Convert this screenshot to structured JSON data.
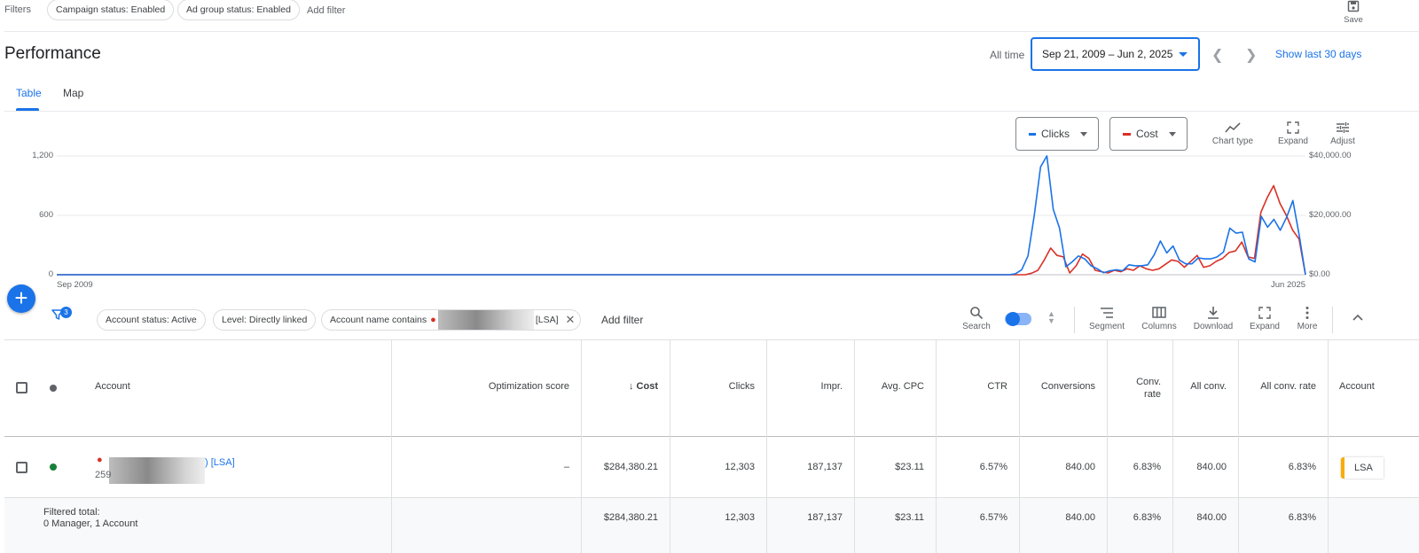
{
  "filters": {
    "label": "Filters",
    "chips": [
      "Campaign status: Enabled",
      "Ad group status: Enabled"
    ],
    "add_filter": "Add filter",
    "save_label": "Save"
  },
  "header": {
    "title": "Performance",
    "range_label": "All time",
    "date_range": "Sep 21, 2009 – Jun 2, 2025",
    "show_last": "Show last 30 days"
  },
  "tabs": [
    "Table",
    "Map"
  ],
  "chart_controls": {
    "metric1": "Clicks",
    "metric2": "Cost",
    "tools": [
      "Chart type",
      "Expand",
      "Adjust"
    ]
  },
  "colors": {
    "clicks": "#1a73e8",
    "cost": "#d93025",
    "accent": "#1a73e8",
    "lsa": "#f9ab00",
    "enabled": "#188038"
  },
  "chart_data": {
    "type": "line",
    "x_start_label": "Sep 2009",
    "x_end_label": "Jun 2025",
    "y_left_ticks": [
      "0",
      "600",
      "1,200"
    ],
    "y_left_range": [
      0,
      1200
    ],
    "y_right_ticks": [
      "$0.00",
      "$20,000.00",
      "$40,000.00"
    ],
    "y_right_range": [
      0,
      40000
    ],
    "series": [
      {
        "name": "Clicks",
        "axis": "left",
        "values": [
          0,
          0,
          0,
          0,
          0,
          0,
          0,
          0,
          0,
          0,
          0,
          0,
          0,
          0,
          0,
          0,
          0,
          0,
          0,
          0,
          0,
          0,
          0,
          0,
          0,
          0,
          0,
          0,
          0,
          0,
          0,
          0,
          0,
          0,
          0,
          0,
          0,
          0,
          0,
          0,
          0,
          0,
          0,
          0,
          0,
          0,
          0,
          0,
          0,
          0,
          0,
          0,
          0,
          0,
          0,
          0,
          0,
          0,
          0,
          0,
          0,
          0,
          0,
          0,
          0,
          0,
          0,
          0,
          0,
          0,
          0,
          0,
          0,
          0,
          0,
          0,
          0,
          0,
          0,
          0,
          0,
          0,
          0,
          0,
          0,
          0,
          0,
          0,
          0,
          0,
          0,
          0,
          0,
          0,
          0,
          0,
          0,
          0,
          0,
          0,
          0,
          0,
          0,
          0,
          0,
          0,
          0,
          0,
          0,
          0,
          0,
          0,
          0,
          0,
          0,
          0,
          0,
          0,
          0,
          0,
          0,
          0,
          0,
          0,
          0,
          0,
          0,
          0,
          0,
          0,
          0,
          0,
          0,
          0,
          0,
          0,
          0,
          0,
          0,
          0,
          0,
          0,
          0,
          0,
          0,
          0,
          0,
          0,
          0,
          0,
          0,
          0,
          10,
          50,
          190,
          600,
          1090,
          1200,
          660,
          470,
          80,
          130,
          190,
          160,
          90,
          60,
          20,
          40,
          50,
          40,
          100,
          90,
          90,
          100,
          200,
          340,
          220,
          290,
          150,
          110,
          110,
          170,
          160,
          160,
          180,
          230,
          470,
          420,
          430,
          160,
          130,
          590,
          480,
          560,
          450,
          580,
          750,
          400,
          0
        ]
      },
      {
        "name": "Cost",
        "axis": "right",
        "values": [
          0,
          0,
          0,
          0,
          0,
          0,
          0,
          0,
          0,
          0,
          0,
          0,
          0,
          0,
          0,
          0,
          0,
          0,
          0,
          0,
          0,
          0,
          0,
          0,
          0,
          0,
          0,
          0,
          0,
          0,
          0,
          0,
          0,
          0,
          0,
          0,
          0,
          0,
          0,
          0,
          0,
          0,
          0,
          0,
          0,
          0,
          0,
          0,
          0,
          0,
          0,
          0,
          0,
          0,
          0,
          0,
          0,
          0,
          0,
          0,
          0,
          0,
          0,
          0,
          0,
          0,
          0,
          0,
          0,
          0,
          0,
          0,
          0,
          0,
          0,
          0,
          0,
          0,
          0,
          0,
          0,
          0,
          0,
          0,
          0,
          0,
          0,
          0,
          0,
          0,
          0,
          0,
          0,
          0,
          0,
          0,
          0,
          0,
          0,
          0,
          0,
          0,
          0,
          0,
          0,
          0,
          0,
          0,
          0,
          0,
          0,
          0,
          0,
          0,
          0,
          0,
          0,
          0,
          0,
          0,
          0,
          0,
          0,
          0,
          0,
          0,
          0,
          0,
          0,
          0,
          0,
          0,
          0,
          0,
          0,
          0,
          0,
          0,
          0,
          0,
          0,
          0,
          0,
          0,
          0,
          0,
          0,
          0,
          0,
          0,
          0,
          0,
          0,
          500,
          1500,
          5000,
          9000,
          6500,
          6000,
          600,
          3000,
          7000,
          5500,
          1500,
          1000,
          600,
          1500,
          1000,
          2000,
          1500,
          3000,
          2000,
          1500,
          2000,
          3500,
          5000,
          4500,
          2500,
          4500,
          6500,
          2500,
          3000,
          4500,
          5500,
          7500,
          8000,
          11000,
          6000,
          5500,
          21000,
          26000,
          30000,
          24000,
          20000,
          15000,
          12000,
          0
        ]
      }
    ]
  },
  "table_toolbar": {
    "badge_count": "3",
    "filter_chips": [
      "Account status: Active",
      "Level: Directly linked",
      "Account name contains"
    ],
    "name_suffix": "[LSA]",
    "add_filter": "Add filter",
    "tools": [
      "Search",
      "Segment",
      "Columns",
      "Download",
      "Expand",
      "More"
    ]
  },
  "table": {
    "headers": {
      "account": "Account",
      "opt_score": "Optimization score",
      "cost": "Cost",
      "clicks": "Clicks",
      "impr": "Impr.",
      "avg_cpc": "Avg. CPC",
      "ctr": "CTR",
      "conversions": "Conversions",
      "conv_rate_1": "Conv.",
      "conv_rate_2": "rate",
      "all_conv": "All conv.",
      "all_conv_rate": "All conv. rate",
      "account_type": "Account"
    },
    "row": {
      "name_suffix": ") [LSA]",
      "id_prefix": "259",
      "opt_score": "–",
      "cost": "$284,380.21",
      "clicks": "12,303",
      "impr": "187,137",
      "avg_cpc": "$23.11",
      "ctr": "6.57%",
      "conversions": "840.00",
      "conv_rate": "6.83%",
      "all_conv": "840.00",
      "all_conv_rate": "6.83%",
      "type": "LSA"
    },
    "total": {
      "label": "Filtered total:",
      "sublabel": "0 Manager, 1 Account",
      "cost": "$284,380.21",
      "clicks": "12,303",
      "impr": "187,137",
      "avg_cpc": "$23.11",
      "ctr": "6.57%",
      "conversions": "840.00",
      "conv_rate": "6.83%",
      "all_conv": "840.00",
      "all_conv_rate": "6.83%"
    }
  }
}
